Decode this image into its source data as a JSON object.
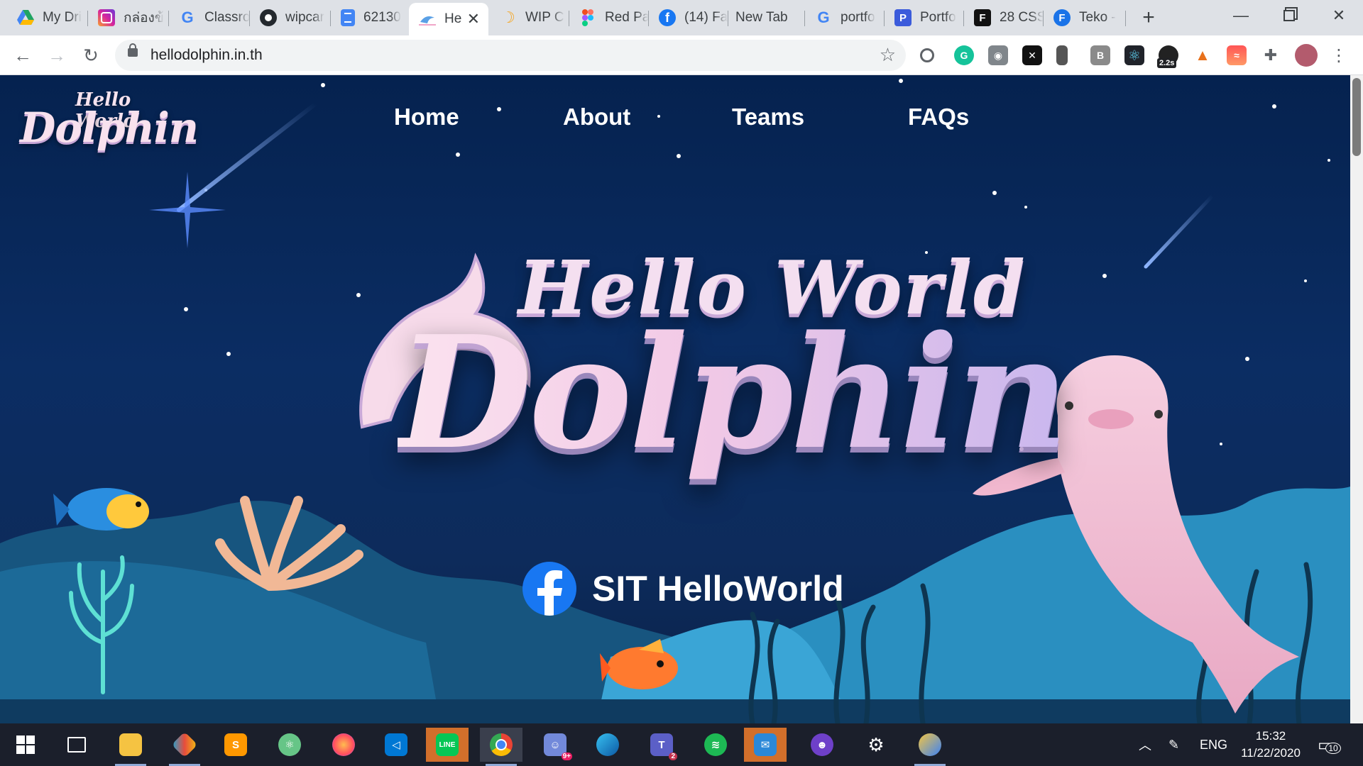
{
  "browser": {
    "tabs": [
      {
        "title": "My Dri",
        "icon": "google-drive-icon",
        "color": "#1fa463"
      },
      {
        "title": "กล่องข้",
        "icon": "instagram-icon",
        "color": "#d6249f"
      },
      {
        "title": "Classro",
        "icon": "google-icon",
        "color": "#4285f4"
      },
      {
        "title": "wipcar",
        "icon": "github-icon",
        "color": "#24292e"
      },
      {
        "title": "62130",
        "icon": "google-docs-icon",
        "color": "#4285f4"
      },
      {
        "title": "He",
        "icon": "hello-dolphin-icon",
        "color": "#5aa0e6"
      },
      {
        "title": "WIP C",
        "icon": "wip-icon",
        "color": "#f5a623"
      },
      {
        "title": "Red Pa",
        "icon": "figma-icon",
        "color": "#f24e1e"
      },
      {
        "title": "(14) Fa",
        "icon": "facebook-icon",
        "color": "#1877f2"
      },
      {
        "title": "New Tab",
        "icon": "",
        "color": ""
      },
      {
        "title": "portfo",
        "icon": "google-icon",
        "color": "#4285f4"
      },
      {
        "title": "Portfo",
        "icon": "portfolio-p-icon",
        "color": "#3b5bdb"
      },
      {
        "title": "28 CSS",
        "icon": "f-icon",
        "color": "#111111"
      },
      {
        "title": "Teko -",
        "icon": "fonts-f-icon",
        "color": "#1a73e8"
      }
    ],
    "active_tab_index": 5,
    "url": "hellodolphin.in.th",
    "extension_badge": "2.2s"
  },
  "page": {
    "logo": {
      "line1": "Hello World",
      "line2": "Dolphin"
    },
    "nav": [
      {
        "label": "Home"
      },
      {
        "label": "About"
      },
      {
        "label": "Teams"
      },
      {
        "label": "FAQs"
      }
    ],
    "hero": {
      "line1": "Hello World",
      "line2": "Dolphin"
    },
    "facebook_link": "SIT HelloWorld"
  },
  "taskbar": {
    "language": "ENG",
    "time": "15:32",
    "date": "11/22/2020",
    "notification_count": "10",
    "teams_badge": "2",
    "discord_badge": "9+"
  },
  "colors": {
    "page_bg": "#05224f",
    "hill_front": "#2a8fc0",
    "hill_back": "#17557f",
    "dolphin_pink": "#f2b8cf",
    "facebook_blue": "#1877f2"
  }
}
